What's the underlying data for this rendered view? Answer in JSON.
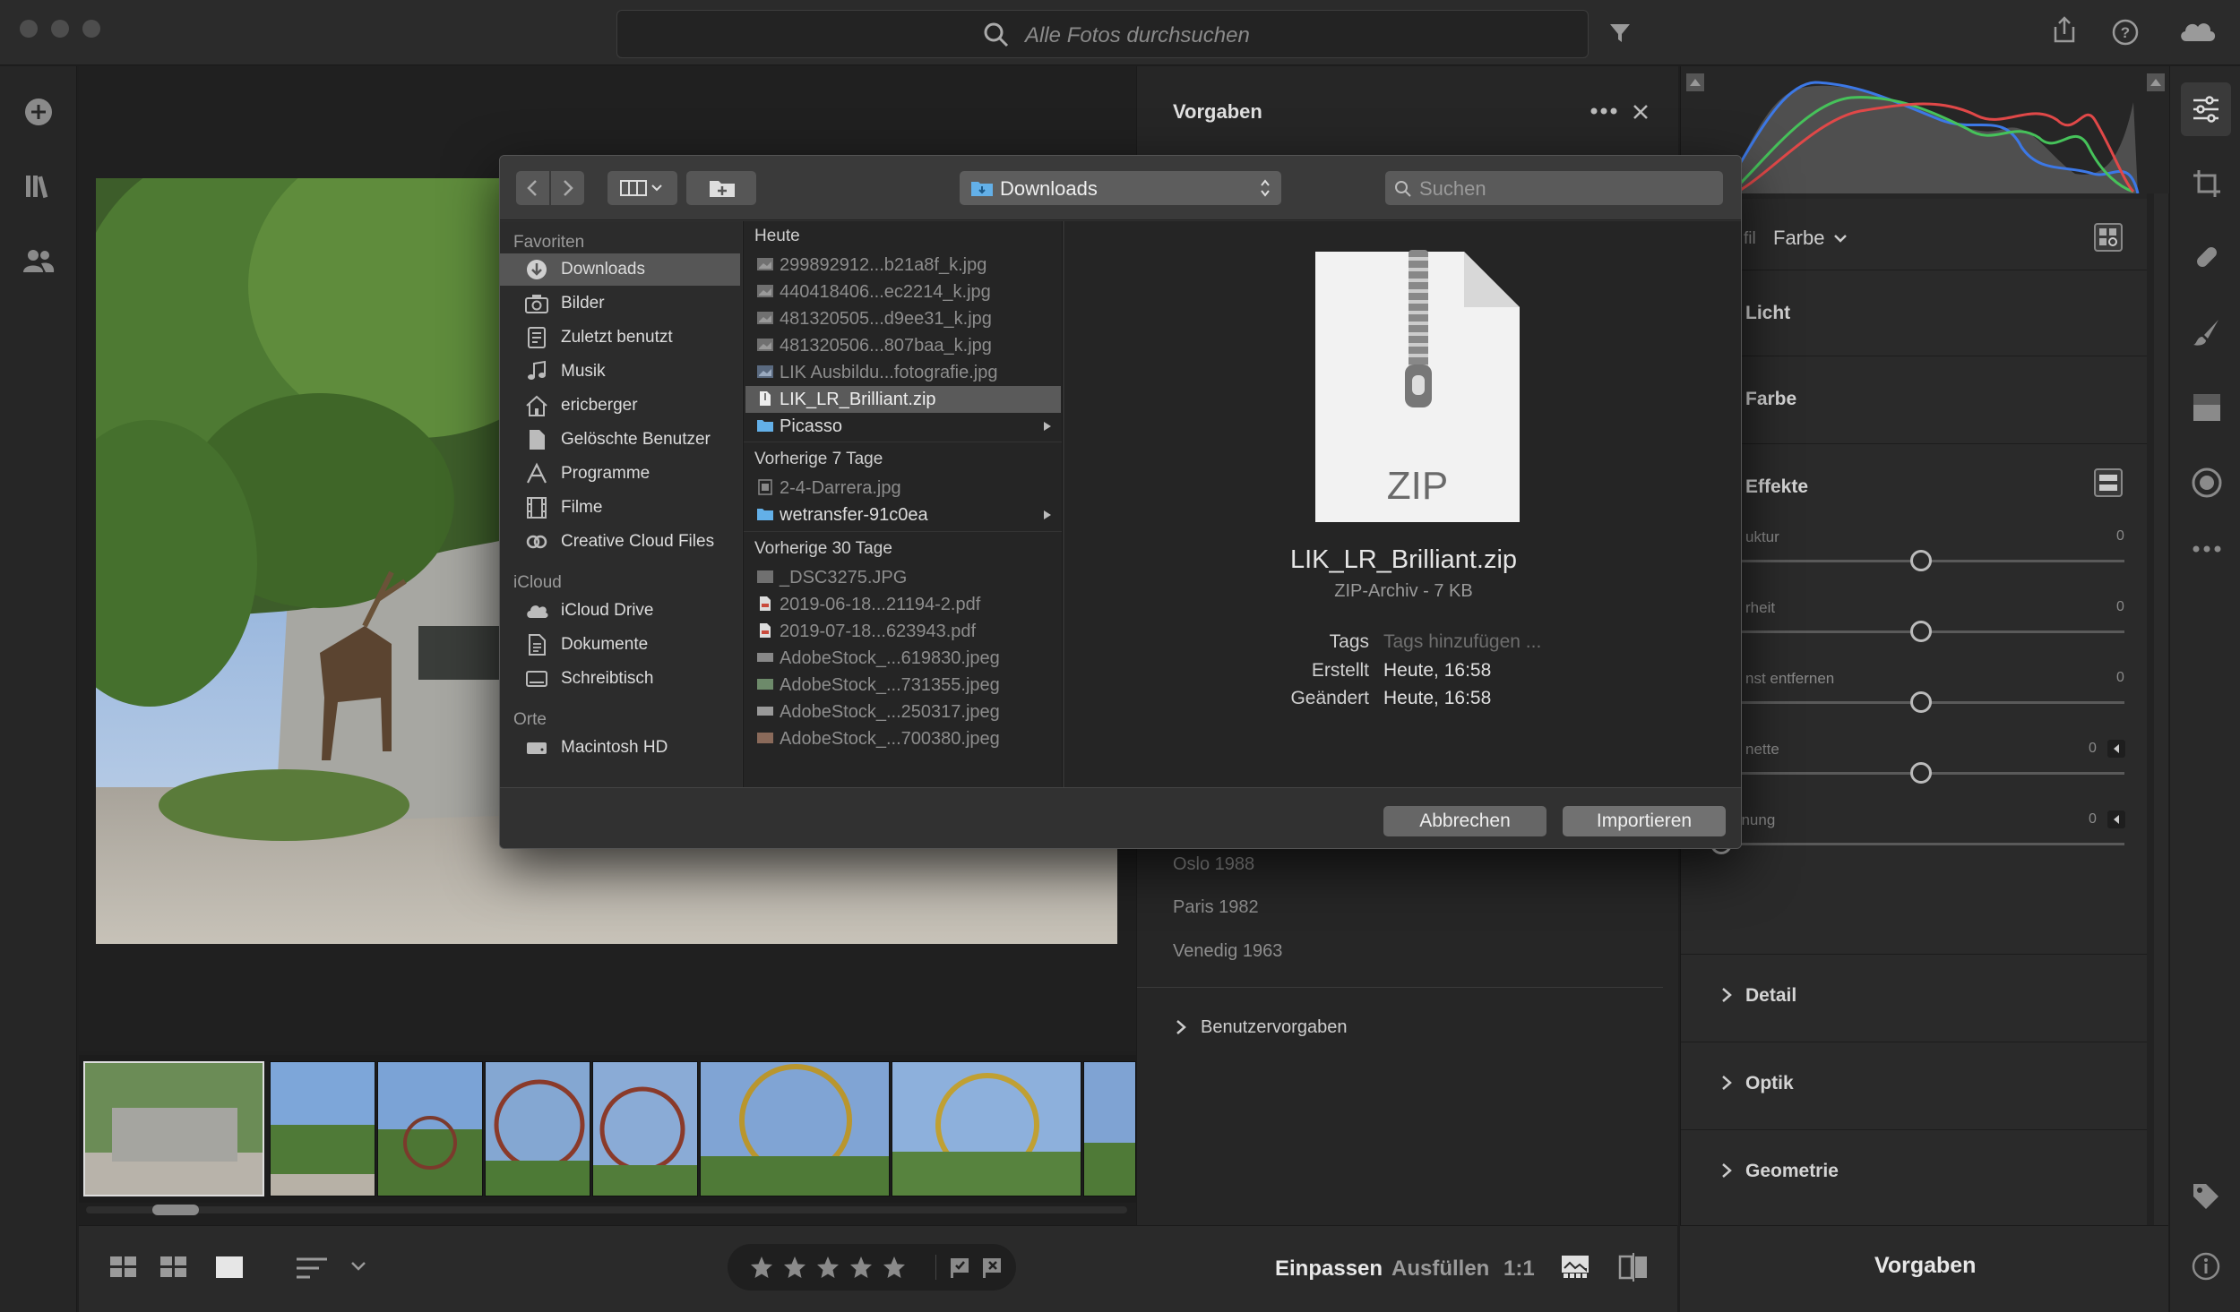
{
  "search": {
    "placeholder": "Alle Fotos durchsuchen"
  },
  "presets": {
    "title": "Vorgaben",
    "items": [
      "Oslo 1988",
      "Paris 1982",
      "Venedig 1963"
    ],
    "user_presets": "Benutzervorgaben"
  },
  "edit": {
    "profile_prefix": "fil",
    "profile_value": "Farbe",
    "sections": {
      "licht": "Licht",
      "farbe": "Farbe",
      "effekte": "Effekte",
      "detail": "Detail",
      "optik": "Optik",
      "geometrie": "Geometrie"
    },
    "sliders": [
      {
        "label": "uktur",
        "value": "0",
        "level": 0.5
      },
      {
        "label": "rheit",
        "value": "0",
        "level": 0.5
      },
      {
        "label": "nst entfernen",
        "value": "0",
        "level": 0.5
      },
      {
        "label": "nette",
        "value": "0",
        "level": 0.5
      },
      {
        "label": "Körnung",
        "value": "0",
        "level": 0
      }
    ]
  },
  "bottom": {
    "fit": "Einpassen",
    "fill": "Ausfüllen",
    "ratio": "1:1",
    "presets_tab": "Vorgaben"
  },
  "dialog": {
    "location": "Downloads",
    "search_placeholder": "Suchen",
    "sidebar": {
      "favorites_header": "Favoriten",
      "favorites": [
        "Downloads",
        "Bilder",
        "Zuletzt benutzt",
        "Musik",
        "ericberger",
        "Gelöschte Benutzer",
        "Programme",
        "Filme",
        "Creative Cloud Files"
      ],
      "icloud_header": "iCloud",
      "icloud": [
        "iCloud Drive",
        "Dokumente",
        "Schreibtisch"
      ],
      "places_header": "Orte",
      "places": [
        "Macintosh HD"
      ]
    },
    "groups": [
      {
        "header": "Heute",
        "files": [
          "299892912...b21a8f_k.jpg",
          "440418406...ec2214_k.jpg",
          "481320505...d9ee31_k.jpg",
          "481320506...807baa_k.jpg",
          "LIK Ausbildu...fotografie.jpg",
          "LIK_LR_Brilliant.zip",
          "Picasso"
        ]
      },
      {
        "header": "Vorherige 7 Tage",
        "files": [
          "2-4-Darrera.jpg",
          "wetransfer-91c0ea"
        ]
      },
      {
        "header": "Vorherige 30 Tage",
        "files": [
          "_DSC3275.JPG",
          "2019-06-18...21194-2.pdf",
          "2019-07-18...623943.pdf",
          "AdobeStock_...619830.jpeg",
          "AdobeStock_...731355.jpeg",
          "AdobeStock_...250317.jpeg",
          "AdobeStock_...700380.jpeg"
        ]
      }
    ],
    "preview": {
      "icon_label": "ZIP",
      "name": "LIK_LR_Brilliant.zip",
      "kind": "ZIP-Archiv - 7 KB",
      "tags_label": "Tags",
      "tags_placeholder": "Tags hinzufügen ...",
      "created_label": "Erstellt",
      "created": "Heute, 16:58",
      "modified_label": "Geändert",
      "modified": "Heute, 16:58"
    },
    "cancel": "Abbrechen",
    "import": "Importieren"
  },
  "colors": {
    "selection": "#5a5a5a",
    "folder": "#63b0e8",
    "accent_histogram_red": "#e04848",
    "accent_histogram_green": "#46c25a",
    "accent_histogram_blue": "#3c78e6"
  }
}
